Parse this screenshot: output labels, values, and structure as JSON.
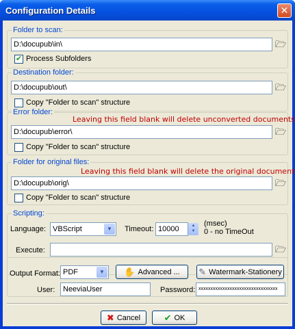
{
  "window": {
    "title": "Configuration Details",
    "close_glyph": "✕"
  },
  "scan": {
    "legend": "Folder to scan:",
    "path": "D:\\docupub\\in\\",
    "process_sub_label": "Process Subfolders",
    "process_sub_checked": true
  },
  "dest": {
    "legend": "Destination folder:",
    "path": "D:\\docupub\\out\\",
    "copy_label": "Copy \"Folder to scan\" structure",
    "copy_checked": false
  },
  "error": {
    "legend": "Error folder:",
    "warning": "Leaving  this field blank will delete unconverted documents.",
    "path": "D:\\docupub\\error\\",
    "copy_label": "Copy \"Folder to scan\" structure",
    "copy_checked": false
  },
  "orig": {
    "legend": "Folder for original files:",
    "warning": "Leaving  this field blank will delete the original documents.",
    "path": "D:\\docupub\\orig\\",
    "copy_label": "Copy \"Folder to scan\" structure",
    "copy_checked": false
  },
  "scripting": {
    "legend": "Scripting:",
    "language_label": "Language:",
    "language_value": "VBScript",
    "timeout_label": "Timeout:",
    "timeout_value": "10000",
    "timeout_unit": "(msec)",
    "timeout_hint": "0 - no TimeOut",
    "execute_label": "Execute:",
    "execute_value": ""
  },
  "output": {
    "format_label": "Output Format:",
    "format_value": "PDF",
    "advanced_label": "Advanced ...",
    "watermark_label": "Watermark-Stationery",
    "user_label": "User:",
    "user_value": "NeeviaUser",
    "password_label": "Password:",
    "password_value": "xxxxxxxxxxxxxxxxxxxxxxxxxxxxxxxxx"
  },
  "footer": {
    "cancel_label": "Cancel",
    "ok_label": "OK"
  },
  "colors": {
    "legend": "#0046d5",
    "warning": "#c00000",
    "titlebar": "#0550e0",
    "dialog_bg": "#ece9d8"
  },
  "icons": {
    "browse": "folder-browse-icon",
    "check": "✔",
    "dropdown": "▼"
  }
}
